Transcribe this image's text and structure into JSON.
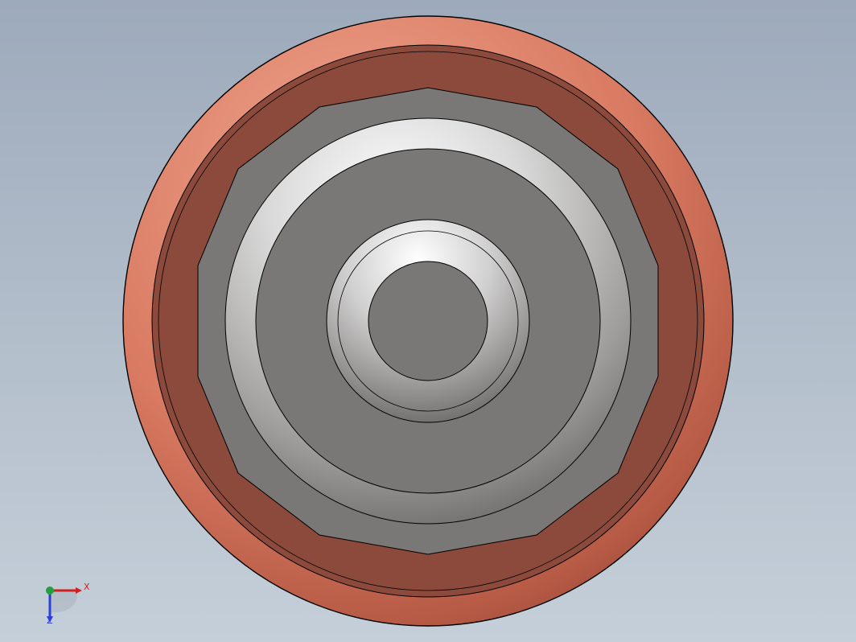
{
  "viewport": {
    "background_top": "#9daabb",
    "background_bottom": "#c5cfd9"
  },
  "model": {
    "description_icon": "wheel-part-icon",
    "colors": {
      "tire_outer": "#d97a62",
      "tire_face": "#8b4a3b",
      "hub_face": "#7a7876",
      "hub_ridge_highlight": "#f2f2f2",
      "edge_lines": "#000000"
    }
  },
  "triad": {
    "x_label": "X",
    "z_label": "Z",
    "x_color": "#d22020",
    "y_color": "#22a03a",
    "z_color": "#2c3fd8"
  }
}
